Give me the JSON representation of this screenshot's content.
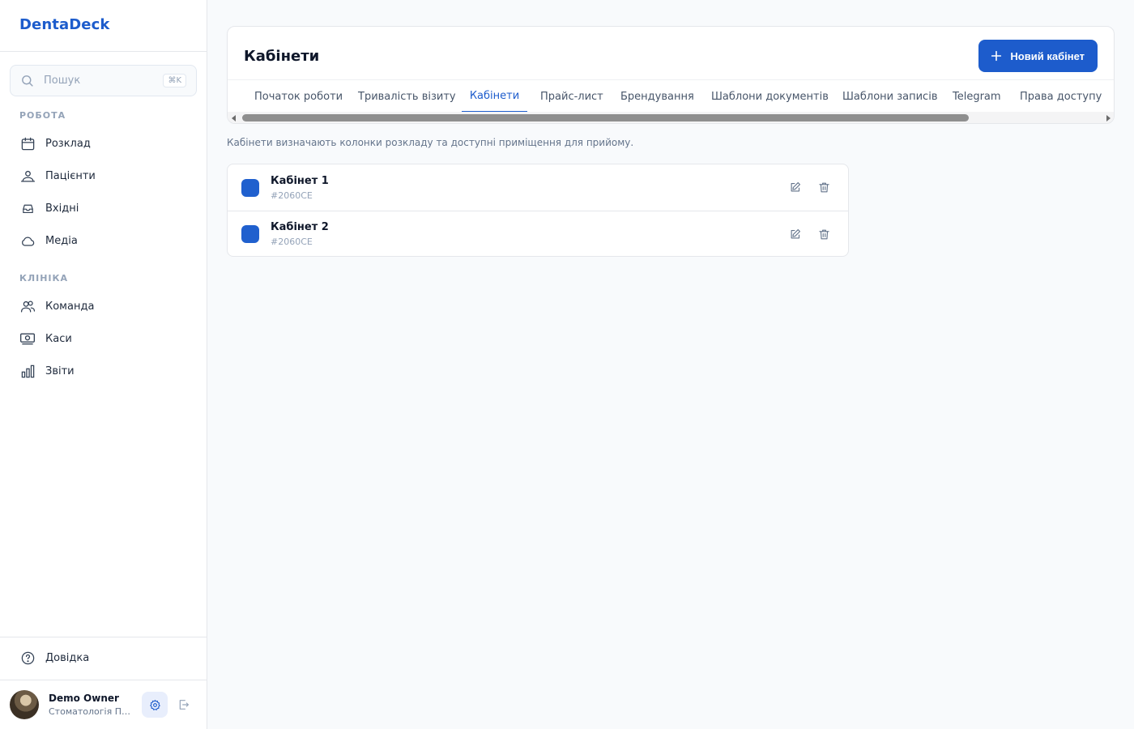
{
  "app": {
    "brand": "DentaDeck"
  },
  "search": {
    "placeholder": "Пошук",
    "shortcut": "⌘K"
  },
  "sidebar": {
    "sections": [
      {
        "label": "РОБОТА",
        "items": [
          {
            "label": "Розклад",
            "icon": "calendar-icon"
          },
          {
            "label": "Пацієнти",
            "icon": "patients-icon"
          },
          {
            "label": "Вхідні",
            "icon": "inbox-icon"
          },
          {
            "label": "Медіа",
            "icon": "cloud-icon"
          }
        ]
      },
      {
        "label": "КЛІНІКА",
        "items": [
          {
            "label": "Команда",
            "icon": "team-icon"
          },
          {
            "label": "Каси",
            "icon": "cash-icon"
          },
          {
            "label": "Звіти",
            "icon": "bar-chart-icon"
          }
        ]
      }
    ],
    "help": {
      "label": "Довідка",
      "icon": "help-icon"
    },
    "user": {
      "name": "Demo Owner",
      "clinic": "Стоматологія Пoділ"
    }
  },
  "page": {
    "title": "Кабінети",
    "new_button": "Новий кабінет",
    "tabs": [
      {
        "label": "Початок роботи",
        "active": false
      },
      {
        "label": "Тривалість візиту",
        "active": false
      },
      {
        "label": "Кабінети",
        "active": true
      },
      {
        "label": "Прайс-лист",
        "active": false
      },
      {
        "label": "Брендування",
        "active": false
      },
      {
        "label": "Шаблони документів",
        "active": false
      },
      {
        "label": "Шаблони записів",
        "active": false
      },
      {
        "label": "Telegram",
        "active": false
      },
      {
        "label": "Права доступу",
        "active": false
      }
    ],
    "description": "Кабінети визначають колонки розкладу та доступні приміщення для прийому.",
    "rooms": [
      {
        "name": "Кабінет 1",
        "color": "#2060CE"
      },
      {
        "name": "Кабінет 2",
        "color": "#2060CE"
      }
    ]
  },
  "colors": {
    "accent": "#1d5ccc",
    "room_swatch": "#2060ce"
  }
}
